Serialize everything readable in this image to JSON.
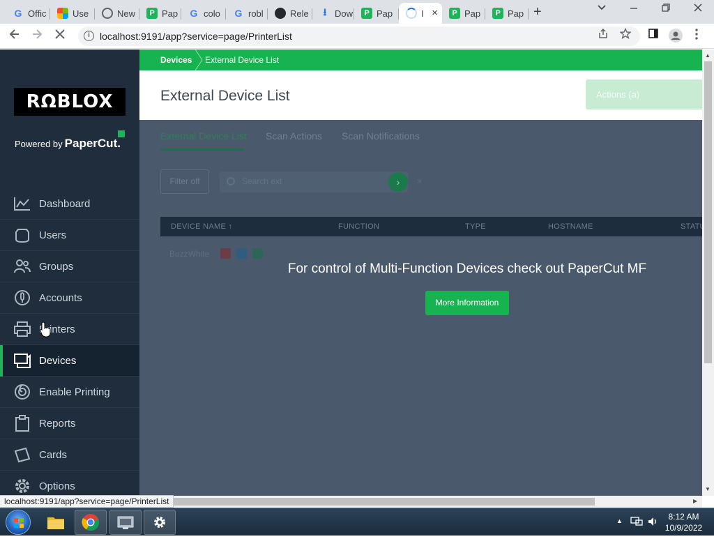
{
  "browser": {
    "tabs": [
      {
        "label": "Offic",
        "icon": "google-icon",
        "color": "#4285f4"
      },
      {
        "label": "Use",
        "icon": "microsoft-icon",
        "color": "#f25022"
      },
      {
        "label": "New",
        "icon": "chromium-icon",
        "color": "#5f6368"
      },
      {
        "label": "Pap",
        "icon": "papercut-icon",
        "color": "#1fb35b"
      },
      {
        "label": "colo",
        "icon": "google-icon",
        "color": "#4285f4"
      },
      {
        "label": "robl",
        "icon": "google-icon",
        "color": "#4285f4"
      },
      {
        "label": "Rele",
        "icon": "github-icon",
        "color": "#24292f"
      },
      {
        "label": "Dow",
        "icon": "download-icon",
        "color": "#1a73e8"
      },
      {
        "label": "Pap",
        "icon": "papercut-icon",
        "color": "#1fb35b"
      },
      {
        "label": "I",
        "icon": "loading-icon",
        "color": "#1a73e8",
        "active": true
      },
      {
        "label": "Pap",
        "icon": "papercut-icon",
        "color": "#1fb35b"
      },
      {
        "label": "Pap",
        "icon": "papercut-icon",
        "color": "#1fb35b"
      }
    ],
    "url": "localhost:9191/app?service=page/PrinterList",
    "status_url": "localhost:9191/app?service=page/PrinterList"
  },
  "sidebar": {
    "logo_text": "RΩBLOX",
    "powered_by": "Powered by",
    "powered_brand": "PaperCut.",
    "items": [
      {
        "label": "Dashboard",
        "icon": "chart-line-icon"
      },
      {
        "label": "Users",
        "icon": "user-icon"
      },
      {
        "label": "Groups",
        "icon": "group-icon"
      },
      {
        "label": "Accounts",
        "icon": "account-icon"
      },
      {
        "label": "Printers",
        "icon": "printer-icon"
      },
      {
        "label": "Devices",
        "icon": "device-icon",
        "active": true
      },
      {
        "label": "Enable Printing",
        "icon": "enable-printing-icon"
      },
      {
        "label": "Reports",
        "icon": "clipboard-icon"
      },
      {
        "label": "Cards",
        "icon": "card-icon"
      },
      {
        "label": "Options",
        "icon": "gear-icon"
      }
    ]
  },
  "breadcrumb": {
    "parent": "Devices",
    "current": "External Device List"
  },
  "page": {
    "title": "External Device List",
    "actions_label": "Actions (a)",
    "tabs": [
      "External Device List",
      "Scan Actions",
      "Scan Notifications"
    ],
    "filter_label": "Filter off",
    "search_placeholder": "Search ext",
    "search_clear": "×",
    "table_headers": [
      "DEVICE NAME ↑",
      "FUNCTION",
      "TYPE",
      "HOSTNAME",
      "STATU"
    ],
    "row_name": "BuzzWhite",
    "promo_text": "For control of Multi-Function Devices check out PaperCut MF",
    "more_info_label": "More Information"
  },
  "taskbar": {
    "time": "8:12 AM",
    "date": "10/9/2022"
  },
  "colors": {
    "brand_green": "#16b350",
    "sidebar_bg": "#1f2d3d",
    "overlay_bg": "#4a5a6c"
  }
}
